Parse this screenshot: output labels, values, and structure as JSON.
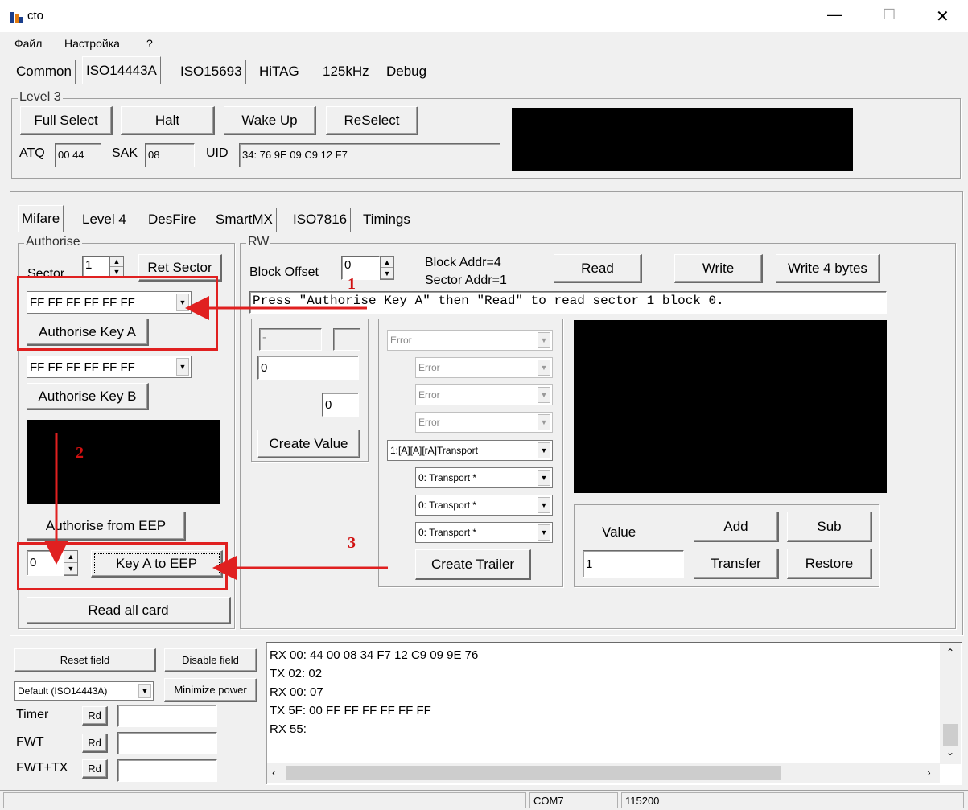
{
  "window": {
    "title": "cto",
    "minimize": "—",
    "maximize": "☐",
    "close": "✕"
  },
  "menu": [
    "Файл",
    "Настройка",
    "?"
  ],
  "top_tabs": [
    "Common",
    "ISO14443A",
    "ISO15693",
    "HiTAG",
    "125kHz",
    "Debug"
  ],
  "level3": {
    "title": "Level 3",
    "full_select": "Full Select",
    "halt": "Halt",
    "wake_up": "Wake Up",
    "reselect": "ReSelect",
    "atq_label": "ATQ",
    "atq": "00 44",
    "sak_label": "SAK",
    "sak": "08",
    "uid_label": "UID",
    "uid": "34: 76 9E 09 C9 12 F7"
  },
  "sub_tabs": [
    "Mifare",
    "Level 4",
    "DesFire",
    "SmartMX",
    "ISO7816",
    "Timings"
  ],
  "authorise": {
    "title": "Authorise",
    "sector_label": "Sector",
    "sector": "1",
    "ret_sector": "Ret Sector",
    "key_a": "FF FF FF FF FF FF",
    "auth_key_a": "Authorise Key A",
    "key_b": "FF FF FF FF FF FF",
    "auth_key_b": "Authorise Key B",
    "auth_eep": "Authorise from EEP",
    "eep_index": "0",
    "key_a_to_eep": "Key A to EEP",
    "read_all": "Read all card"
  },
  "rw": {
    "title": "RW",
    "block_offset_label": "Block Offset",
    "block_offset": "0",
    "block_addr": "Block Addr=4",
    "sector_addr": "Sector Addr=1",
    "read": "Read",
    "write": "Write",
    "write4": "Write 4 bytes",
    "hint": "Press \"Authorise Key A\" then \"Read\" to read sector 1 block 0.",
    "val_f1": "-",
    "val_f2": "",
    "val_f3": "0",
    "val_f4": "0",
    "create_value": "Create Value",
    "err1": "Error",
    "err2": "Error",
    "err3": "Error",
    "err4": "Error",
    "access": "1:[A][A][rA]Transport",
    "t1": "0: Transport *",
    "t2": "0: Transport *",
    "t3": "0: Transport *",
    "create_trailer": "Create Trailer",
    "value_label": "Value",
    "value": "1",
    "add": "Add",
    "sub": "Sub",
    "transfer": "Transfer",
    "restore": "Restore"
  },
  "bottom": {
    "reset_field": "Reset field",
    "disable_field": "Disable field",
    "mode": "Default (ISO14443A)",
    "minimize_power": "Minimize power",
    "timer_label": "Timer",
    "fwt_label": "FWT",
    "fwttx_label": "FWT+TX",
    "rd": "Rd"
  },
  "log": [
    "RX 00: 44 00 08 34 F7 12 C9 09 9E 76",
    "TX 02: 02",
    "RX 00: 07",
    "TX 5F: 00 FF FF FF FF FF FF",
    "RX 55:"
  ],
  "status": {
    "port": "COM7",
    "baud": "115200"
  },
  "annotations": {
    "n1": "1",
    "n2": "2",
    "n3": "3"
  },
  "colors": {
    "annotation_red": "#e02020",
    "display_black": "#000000"
  }
}
